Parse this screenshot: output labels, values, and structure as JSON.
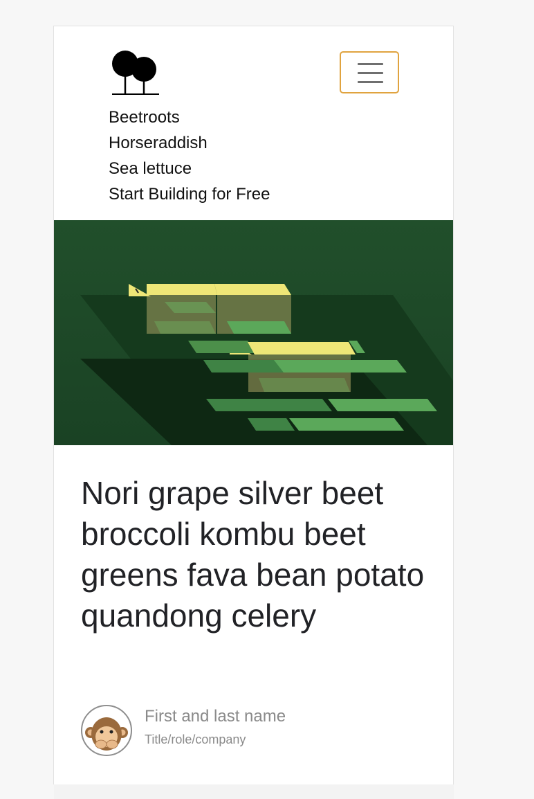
{
  "header": {
    "logo_icon": "two-trees-icon",
    "menu_icon": "hamburger-menu-icon",
    "menu_button_color": "#e0a33f"
  },
  "nav": {
    "items": [
      "Beetroots",
      "Horseraddish",
      "Sea lettuce",
      "Start Building for Free"
    ]
  },
  "hero": {
    "image": "green isometric blocks illustration",
    "colors": {
      "background": "#1f4a28",
      "highlight": "#eee677",
      "bar": "#5ba85a"
    }
  },
  "article": {
    "title": "Nori grape silver beet broccoli kombu beet greens fava bean potato quandong celery"
  },
  "author": {
    "name": "First and last name",
    "role": "Title/role/company",
    "avatar_icon": "monkey-avatar-icon"
  }
}
